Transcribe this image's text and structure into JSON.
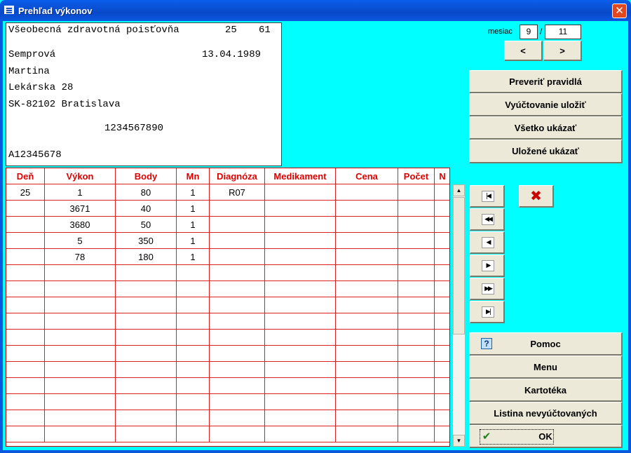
{
  "window": {
    "title": "Prehľad výkonov",
    "close_glyph": "✕"
  },
  "patient": {
    "insurer": "Všeobecná zdravotná poisťovňa",
    "insurer_code1": "25",
    "insurer_code2": "61",
    "surname": "Semprová",
    "birth_date": "13.04.1989",
    "first_name": "Martina",
    "street": "Lekárska 28",
    "city": "SK-82102 Bratislava",
    "id_number": "1234567890",
    "code": "A12345678"
  },
  "month": {
    "label": "mesiac",
    "value": "9",
    "slash": "/",
    "total": "11",
    "prev_label": "<",
    "next_label": ">"
  },
  "actions": {
    "check_rules": "Preveriť pravidlá",
    "save_billing": "Vyúčtovanie uložiť",
    "show_all": "Všetko ukázať",
    "show_saved": "Uložené ukázať"
  },
  "grid": {
    "columns": [
      "Deň",
      "Výkon",
      "Body",
      "Mn",
      "Diagnóza",
      "Medikament",
      "Cena",
      "Počet",
      "N"
    ],
    "rows": [
      [
        "25",
        "1",
        "80",
        "1",
        "R07",
        "",
        "",
        "",
        ""
      ],
      [
        "",
        "3671",
        "40",
        "1",
        "",
        "",
        "",
        "",
        ""
      ],
      [
        "",
        "3680",
        "50",
        "1",
        "",
        "",
        "",
        "",
        ""
      ],
      [
        "",
        "5",
        "350",
        "1",
        "",
        "",
        "",
        "",
        ""
      ],
      [
        "",
        "78",
        "180",
        "1",
        "",
        "",
        "",
        "",
        ""
      ]
    ],
    "empty_rows": 11
  },
  "navigation": {
    "first": "|◀",
    "prev_page": "◀◀",
    "prev": "◀",
    "next": "▶",
    "next_page": "▶▶",
    "last": "▶|",
    "delete_glyph": "✖",
    "scroll_up": "▲",
    "scroll_down": "▼"
  },
  "bottom": {
    "help": "Pomoc",
    "help_glyph": "?",
    "menu": "Menu",
    "card_file": "Kartotéka",
    "unbilled_list": "Listina nevyúčtovaných",
    "ok": "OK",
    "ok_glyph": "✔"
  }
}
